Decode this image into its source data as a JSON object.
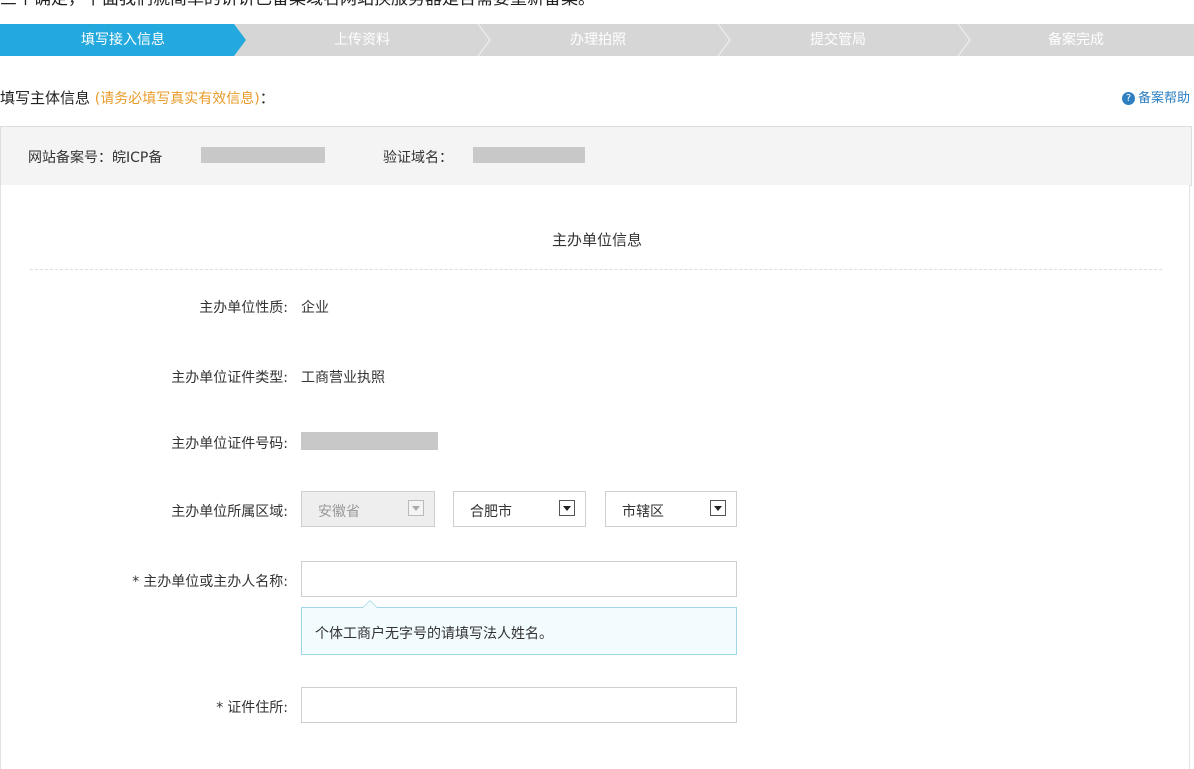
{
  "top_caption": "三个确定，下面我们就简单的讲讲已备案域名网站换服务器是否需要重新备案。",
  "steps": [
    {
      "label": "填写接入信息"
    },
    {
      "label": "上传资料"
    },
    {
      "label": "办理拍照"
    },
    {
      "label": "提交管局"
    },
    {
      "label": "备案完成"
    }
  ],
  "header": {
    "title": "填写主体信息",
    "note": "(请务必填写真实有效信息)",
    "colon": "：",
    "help_label": "备案帮助"
  },
  "record": {
    "icp_label": "网站备案号：",
    "icp_prefix": "皖ICP备",
    "domain_label": "验证域名："
  },
  "form": {
    "heading": "主办单位信息",
    "fields": {
      "nature_label": "主办单位性质:",
      "nature_value": "企业",
      "cert_type_label": "主办单位证件类型:",
      "cert_type_value": "工商营业执照",
      "cert_no_label": "主办单位证件号码:",
      "region_label": "主办单位所属区域:",
      "province": "安徽省",
      "city": "合肥市",
      "district": "市辖区",
      "name_label": "主办单位或主办人名称:",
      "name_tip": "个体工商户无字号的请填写法人姓名。",
      "address_label": "证件住所:",
      "required_mark": "*"
    }
  },
  "colors": {
    "active_step": "#23a9dd",
    "inactive_step": "#d6d6d6",
    "note": "#e99b2a",
    "help": "#2d7fc1",
    "tip_bg": "#f2fbfd",
    "tip_border": "#9ed6e6"
  },
  "icons": [
    "help-circle-icon",
    "chevron-down-icon"
  ]
}
